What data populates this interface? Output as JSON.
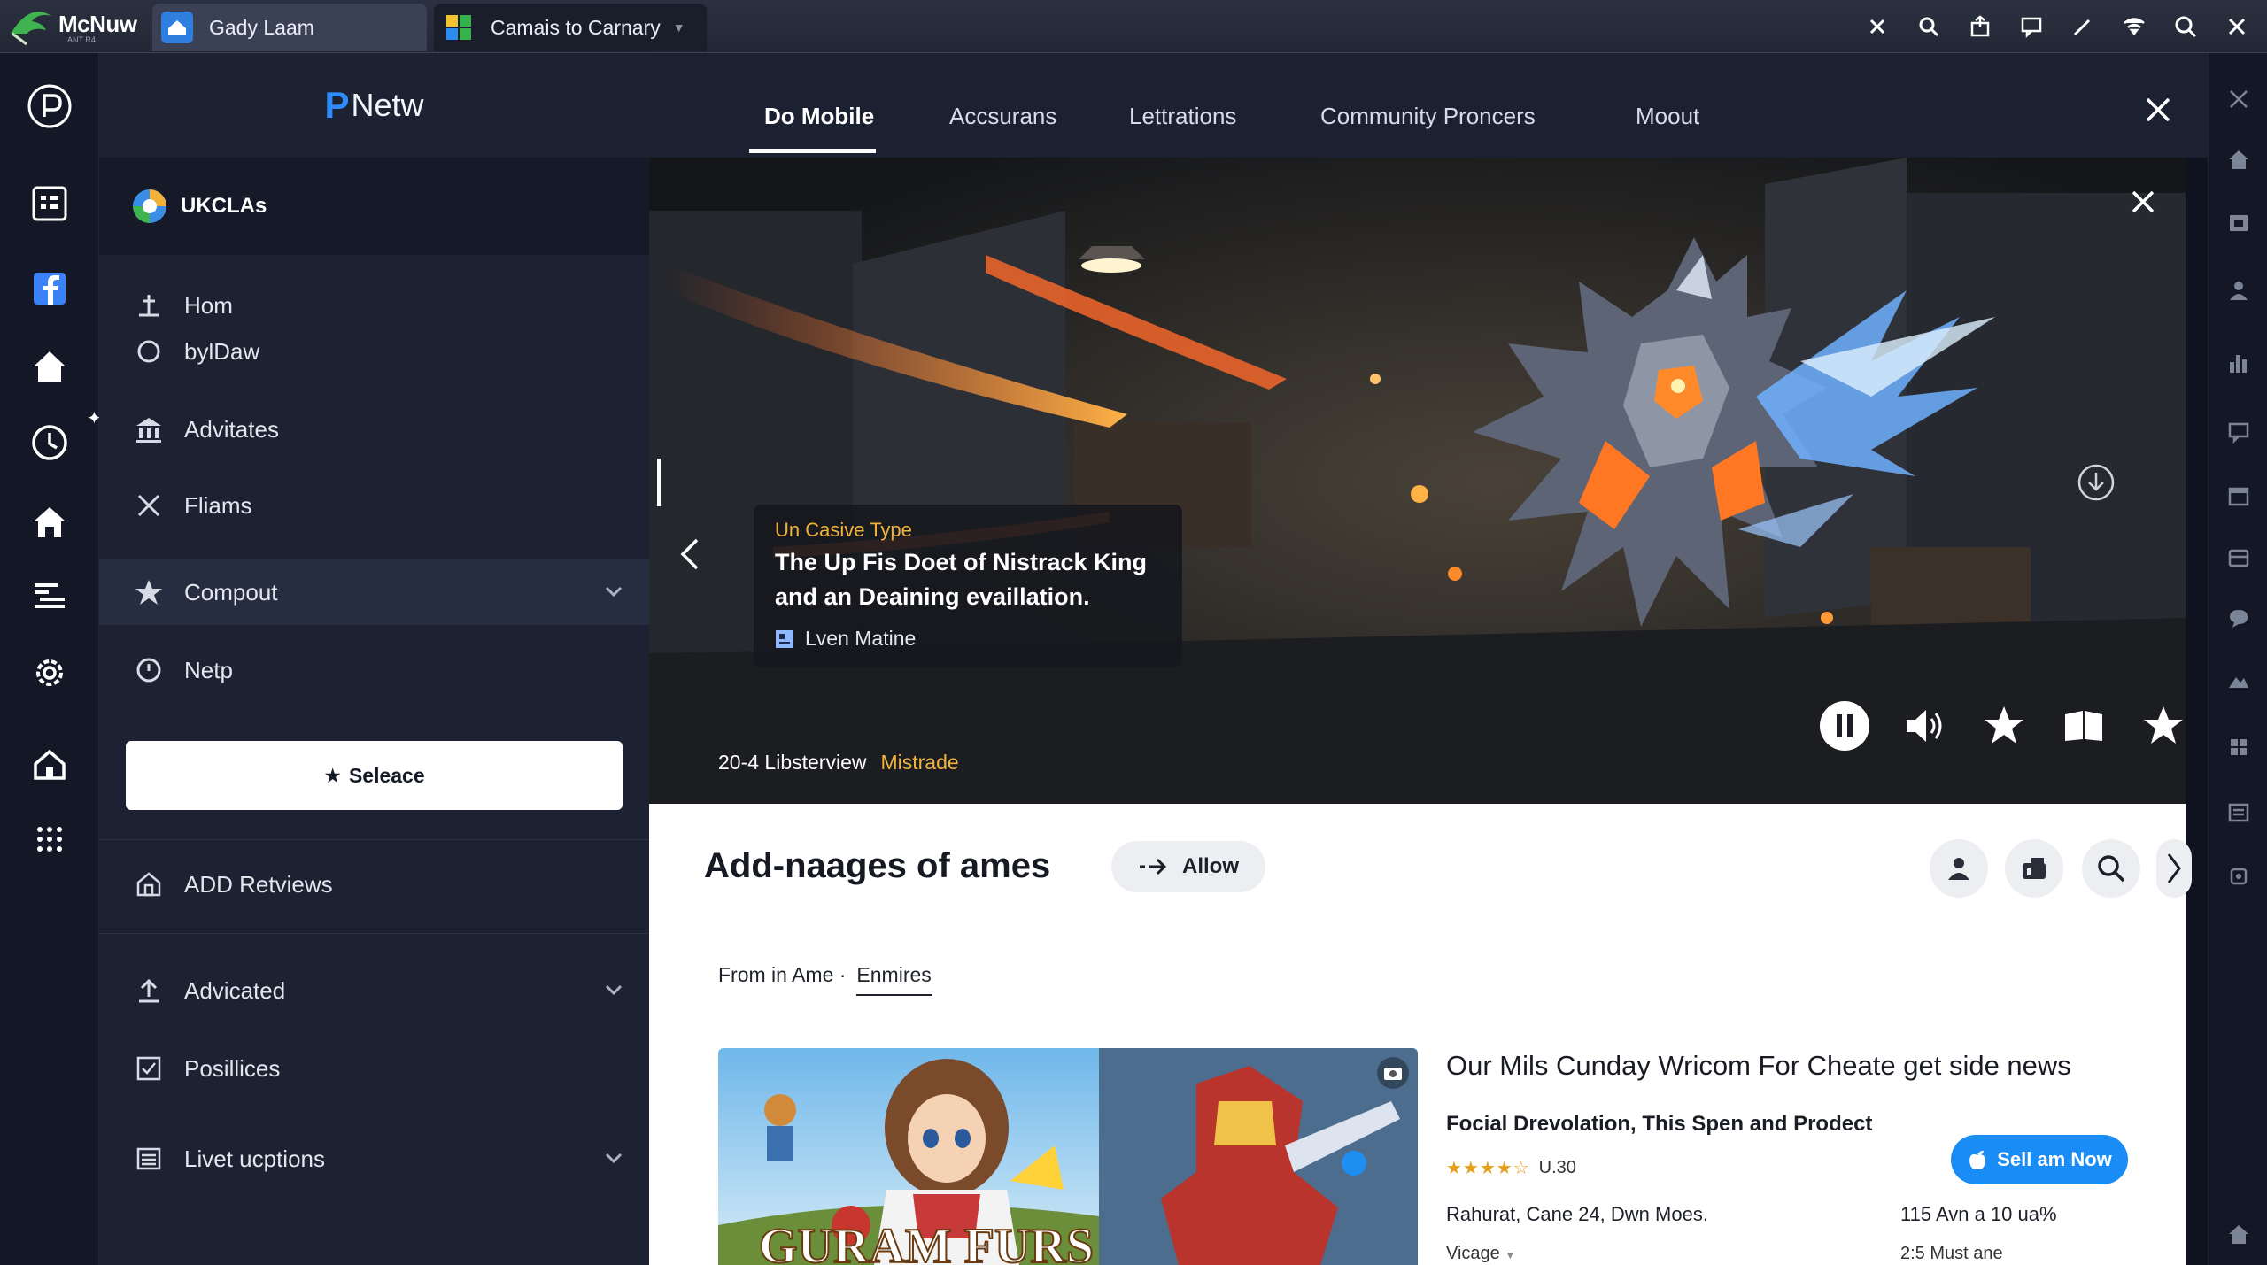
{
  "browser": {
    "app_name": "McNuw",
    "app_sub": "ANT R4",
    "tabs": [
      {
        "label": "Gady Laam"
      },
      {
        "label": "Camais to  Carnary"
      }
    ]
  },
  "sidebar": {
    "brand": "Netw",
    "brand_letter": "P",
    "account": "UKCLAs",
    "items": [
      {
        "label": "Hom",
        "icon": "anchor-icon"
      },
      {
        "label": "bylDaw",
        "icon": "circle-icon"
      },
      {
        "label": "Advitates",
        "icon": "bank-icon"
      },
      {
        "label": "Fliams",
        "icon": "tools-icon"
      },
      {
        "label": "Compout",
        "icon": "star-icon"
      },
      {
        "label": "Netp",
        "icon": "clock-icon"
      },
      {
        "label": "ADD Retviews",
        "icon": "house-icon"
      },
      {
        "label": "Advicated",
        "icon": "upload-icon"
      },
      {
        "label": "Posillices",
        "icon": "checkbox-icon"
      },
      {
        "label": "Livet ucptions",
        "icon": "list-icon"
      }
    ],
    "select_button": "Seleace"
  },
  "header": {
    "tabs": [
      {
        "label": "Do Mobile"
      },
      {
        "label": "Accsurans"
      },
      {
        "label": "Lettrations"
      },
      {
        "label": "Community Proncers"
      },
      {
        "label": "Moout"
      }
    ],
    "active_tab": "Do Mobile"
  },
  "hero": {
    "kicker": "Un Casive Type",
    "title_line1": "The Up Fis Doet of Nistrack King",
    "title_line2": "and an Deaining evaillation.",
    "author": "Lven Matine",
    "meta": "20-4 Libsterview",
    "meta_tag": "Mistrade"
  },
  "content": {
    "section_title": "Add-naages of ames",
    "allow_button": "Allow",
    "filters": {
      "first": "From in Ame ·",
      "second": "Enmires"
    },
    "card": {
      "image_title": "GURAM FURS",
      "title": "Our Mils Cunday Wricom For Cheate get side news",
      "subtitle": "Focial Drevolation, This Spen and Prodect",
      "rating_value": 4,
      "rating_stars": "★★★★☆",
      "rating_label": "U.30",
      "location": "Rahurat, Cane 24, Dwn Moes.",
      "count": "115 Avn a 10 ua%",
      "vicage": "Vicage",
      "must": "2:5 Must ane",
      "sell_button": "Sell am Now"
    }
  },
  "colors": {
    "accent": "#2e8cff",
    "highlight": "#f2b23a",
    "sell": "#1a8cf5"
  }
}
